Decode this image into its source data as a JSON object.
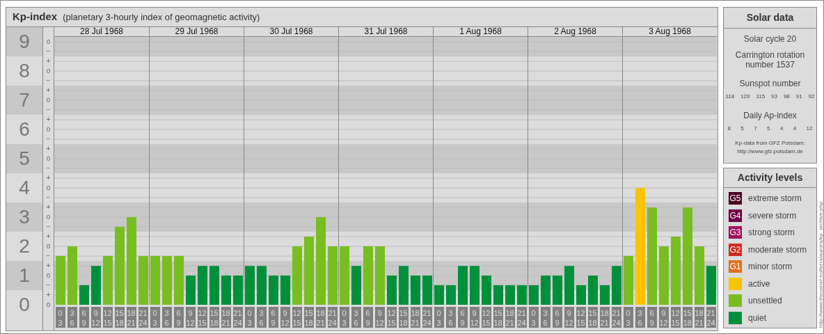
{
  "header": {
    "title": "Kp-index",
    "subtitle": "(planetary 3-hourly index of geomagnetic activity)"
  },
  "days": [
    "28 Jul 1968",
    "29 Jul 1968",
    "30 Jul 1968",
    "31 Jul 1968",
    "1 Aug 1968",
    "2 Aug 1968",
    "3 Aug 1968"
  ],
  "y_subticks": [
    "o",
    "−",
    "+",
    "o",
    "−",
    "+",
    "o",
    "−",
    "+",
    "o",
    "−",
    "+",
    "o",
    "−",
    "+",
    "o",
    "−",
    "+",
    "o",
    "−",
    "+",
    "o",
    "−",
    "+",
    "o",
    "−",
    "+",
    "o"
  ],
  "chart_data": {
    "type": "bar",
    "ylim": [
      0,
      9.17
    ],
    "yticks": [
      0,
      1,
      2,
      3,
      4,
      5,
      6,
      7,
      8,
      9
    ],
    "grid": true,
    "categories": [
      "0 3",
      "3 6",
      "6 9",
      "9 12",
      "12 15",
      "15 18",
      "18 21",
      "21 24",
      "0 3",
      "3 6",
      "6 9",
      "9 12",
      "12 15",
      "15 18",
      "18 21",
      "21 24",
      "0 3",
      "3 6",
      "6 9",
      "9 12",
      "12 15",
      "15 18",
      "18 21",
      "21 24",
      "0 3",
      "3 6",
      "6 9",
      "9 12",
      "12 15",
      "15 18",
      "18 21",
      "21 24",
      "0 3",
      "3 6",
      "6 9",
      "9 12",
      "12 15",
      "15 18",
      "18 21",
      "21 24",
      "0 3",
      "3 6",
      "6 9",
      "9 12",
      "12 15",
      "15 18",
      "18 21",
      "21 24",
      "0 3",
      "3 6",
      "6 9",
      "9 12",
      "12 15",
      "15 18",
      "18 21",
      "21 24"
    ],
    "series": [
      {
        "name": "quiet",
        "color": "#00903c",
        "values": [
          null,
          null,
          0.67,
          1.33,
          null,
          null,
          null,
          null,
          null,
          null,
          null,
          1,
          1.33,
          1.33,
          1,
          1,
          1.33,
          1.33,
          1,
          1,
          null,
          null,
          null,
          null,
          null,
          1.33,
          null,
          null,
          1,
          1.33,
          1,
          1,
          0.67,
          0.67,
          1.33,
          1.33,
          1,
          0.67,
          0.67,
          0.67,
          0.67,
          1,
          1,
          1.33,
          0.67,
          1,
          0.67,
          1.33,
          null,
          null,
          null,
          null,
          null,
          null,
          null,
          1.33
        ]
      },
      {
        "name": "unsettled",
        "color": "#78be20",
        "values": [
          1.67,
          2,
          null,
          null,
          1.67,
          2.67,
          3,
          1.67,
          1.67,
          1.67,
          1.67,
          null,
          null,
          null,
          null,
          null,
          null,
          null,
          null,
          null,
          2,
          2.33,
          3,
          2,
          2,
          null,
          2,
          2,
          null,
          null,
          null,
          null,
          null,
          null,
          null,
          null,
          null,
          null,
          null,
          null,
          null,
          null,
          null,
          null,
          null,
          null,
          null,
          null,
          1.67,
          null,
          3.33,
          2,
          2.33,
          3.33,
          2,
          null
        ]
      },
      {
        "name": "active",
        "color": "#f8c500",
        "values": [
          null,
          null,
          null,
          null,
          null,
          null,
          null,
          null,
          null,
          null,
          null,
          null,
          null,
          null,
          null,
          null,
          null,
          null,
          null,
          null,
          null,
          null,
          null,
          null,
          null,
          null,
          null,
          null,
          null,
          null,
          null,
          null,
          null,
          null,
          null,
          null,
          null,
          null,
          null,
          null,
          null,
          null,
          null,
          null,
          null,
          null,
          null,
          null,
          null,
          4,
          null,
          null,
          null,
          null,
          null,
          null
        ]
      }
    ]
  },
  "solar_data": {
    "title": "Solar data",
    "solar_cycle": "Solar cycle 20",
    "carrington": "Carrington rotation number 1537",
    "sunspot_title": "Sunspot number",
    "sunspot_numbers": [
      "118",
      "129",
      "115",
      "93",
      "98",
      "91",
      "92"
    ],
    "ap_title": "Daily Ap-index",
    "ap_values": [
      "8",
      "5",
      "7",
      "5",
      "4",
      "4",
      "12"
    ],
    "source": "Kp-data from GFZ Potsdam:",
    "source_url": "http://www.gfz-potsdam.de"
  },
  "activity_levels": {
    "title": "Activity levels",
    "items": [
      {
        "badge": "G5",
        "label": "extreme storm",
        "color": "#4a0022"
      },
      {
        "badge": "G4",
        "label": "severe storm",
        "color": "#6e0040"
      },
      {
        "badge": "G3",
        "label": "strong storm",
        "color": "#a0105a"
      },
      {
        "badge": "G2",
        "label": "moderate storm",
        "color": "#d02a1e"
      },
      {
        "badge": "G1",
        "label": "minor storm",
        "color": "#e07020"
      }
    ]
  },
  "credit": "http://www.theusner.eu/terra/aurora/kp_archive.php"
}
